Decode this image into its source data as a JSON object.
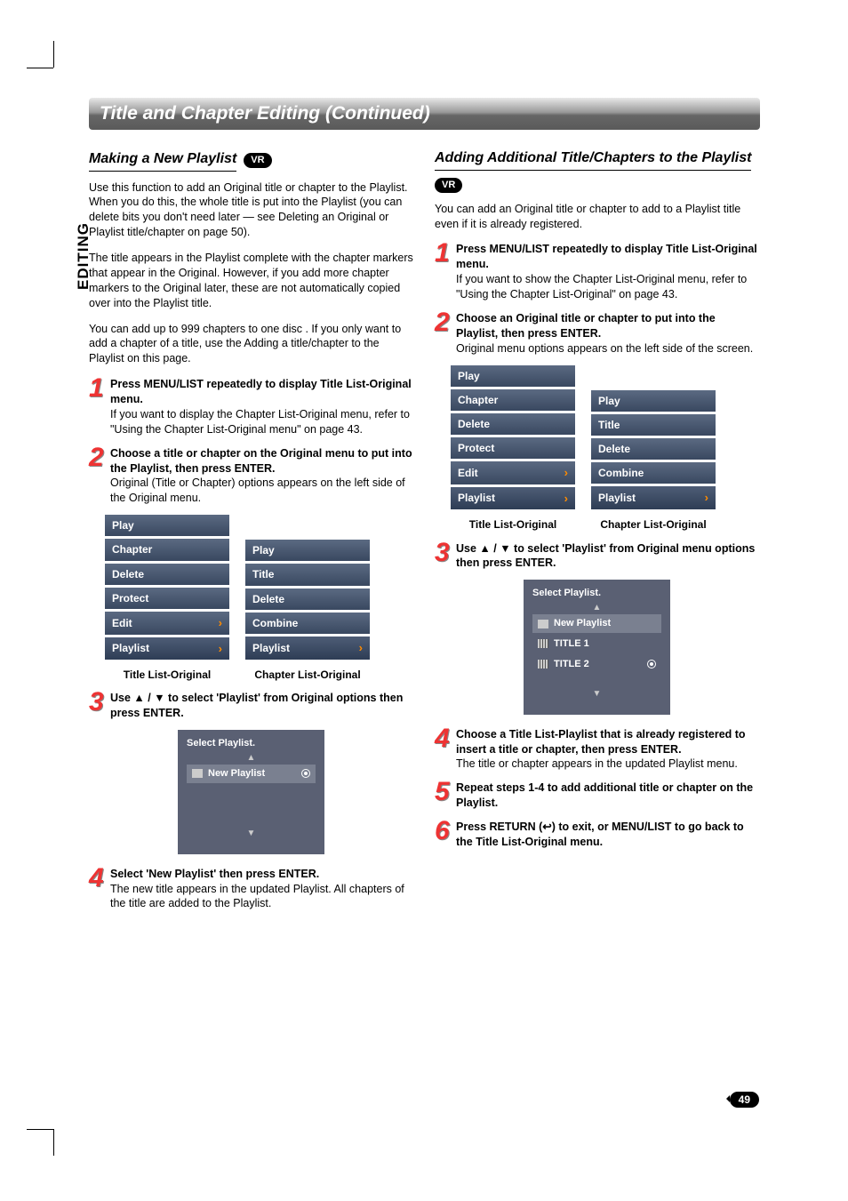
{
  "page_number": "49",
  "side_tab": "EDITING",
  "title_bar": "Title and Chapter Editing (Continued)",
  "badges": {
    "vr": "VR"
  },
  "left": {
    "heading": "Making a New Playlist",
    "p1": "Use this function to add an Original title or chapter to the Playlist. When you do this, the whole title is put into the Playlist (you can delete bits you don't need later — see Deleting an Original or Playlist title/chapter on page 50).",
    "p2": "The title appears in the Playlist complete with the chapter markers that appear in the Original. However, if you add more chapter markers to the Original later, these are not automatically copied over into the Playlist title.",
    "p3": "You can add up to 999 chapters to one disc . If you only want to add a chapter of a title, use the Adding a title/chapter to the Playlist on this page.",
    "step1_b": "Press MENU/LIST repeatedly to display Title List-Original menu.",
    "step1_t": "If you want to display the Chapter List-Original menu, refer to \"Using the Chapter List-Original menu\" on page 43.",
    "step2_b": "Choose a title or chapter on the Original menu to put into the Playlist, then press ENTER.",
    "step2_t": "Original (Title or Chapter) options appears on the left side of the Original menu.",
    "step3_b": "Use ▲ / ▼ to select 'Playlist' from Original options then press ENTER.",
    "step4_b": "Select 'New Playlist' then press ENTER.",
    "step4_t": "The new title appears in the updated Playlist. All chapters of the title are added to the Playlist.",
    "menu_title_items": [
      "Play",
      "Chapter",
      "Delete",
      "Protect",
      "Edit",
      "Playlist"
    ],
    "menu_chapter_items": [
      "Play",
      "Title",
      "Delete",
      "Combine",
      "Playlist"
    ],
    "menu_caption_left": "Title List-Original",
    "menu_caption_right": "Chapter List-Original",
    "select_title": "Select Playlist.",
    "select_items": [
      "New Playlist"
    ]
  },
  "right": {
    "heading": "Adding Additional Title/Chapters to the Playlist",
    "p1": "You can add an Original title or chapter to add to a Playlist title even if it is already registered.",
    "step1_b": "Press MENU/LIST repeatedly to display Title List-Original menu.",
    "step1_t": "If you want to show the Chapter List-Original menu, refer to \"Using the Chapter List-Original\" on page 43.",
    "step2_b": "Choose an Original title or chapter to put into the Playlist, then press ENTER.",
    "step2_t": "Original menu options appears on the left side of the screen.",
    "step3_b": "Use ▲ / ▼ to select 'Playlist' from Original menu options then press ENTER.",
    "step4_b": "Choose a Title List-Playlist that is already registered to insert a title or chapter, then press ENTER.",
    "step4_t": "The title or chapter appears in the updated Playlist menu.",
    "step5_b": "Repeat steps 1-4 to add additional title or chapter on the Playlist.",
    "step6_b": "Press RETURN (↩) to exit, or MENU/LIST to go back to the Title List-Original menu.",
    "menu_title_items": [
      "Play",
      "Chapter",
      "Delete",
      "Protect",
      "Edit",
      "Playlist"
    ],
    "menu_chapter_items": [
      "Play",
      "Title",
      "Delete",
      "Combine",
      "Playlist"
    ],
    "menu_caption_left": "Title List-Original",
    "menu_caption_right": "Chapter List-Original",
    "select_title": "Select Playlist.",
    "select_items": [
      "New Playlist",
      "TITLE 1",
      "TITLE 2"
    ]
  }
}
